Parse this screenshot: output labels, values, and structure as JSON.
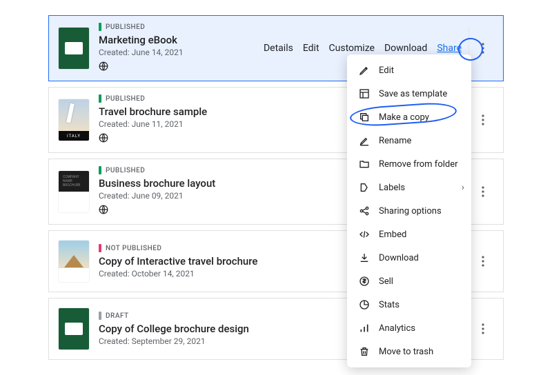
{
  "labels": {
    "created": "Created:",
    "details": "Details",
    "edit": "Edit",
    "customize": "Customize",
    "download": "Download",
    "share": "Share"
  },
  "status": {
    "published": "PUBLISHED",
    "not_published": "NOT PUBLISHED",
    "draft": "DRAFT"
  },
  "items": [
    {
      "title": "Marketing eBook",
      "date": "June 14, 2021",
      "status": "published",
      "selected": true,
      "show_customize": true
    },
    {
      "title": "Travel brochure sample",
      "date": "June 11, 2021",
      "status": "published",
      "selected": false,
      "show_customize": false
    },
    {
      "title": "Business brochure layout",
      "date": "June 09, 2021",
      "status": "published",
      "selected": false,
      "show_customize": false
    },
    {
      "title": "Copy of Interactive travel brochure",
      "date": "October 14, 2021",
      "status": "not_published",
      "selected": false,
      "show_customize": false
    },
    {
      "title": "Copy of College brochure design",
      "date": "September 29, 2021",
      "status": "draft",
      "selected": false,
      "show_customize": false
    }
  ],
  "menu": [
    {
      "icon": "pencil",
      "label": "Edit"
    },
    {
      "icon": "template",
      "label": "Save as template"
    },
    {
      "icon": "copy",
      "label": "Make a copy"
    },
    {
      "icon": "rename",
      "label": "Rename"
    },
    {
      "icon": "remove-folder",
      "label": "Remove from folder"
    },
    {
      "icon": "label",
      "label": "Labels",
      "submenu": true
    },
    {
      "icon": "share",
      "label": "Sharing options"
    },
    {
      "icon": "embed",
      "label": "Embed"
    },
    {
      "icon": "download",
      "label": "Download"
    },
    {
      "icon": "sell",
      "label": "Sell"
    },
    {
      "icon": "stats",
      "label": "Stats"
    },
    {
      "icon": "analytics",
      "label": "Analytics"
    },
    {
      "icon": "trash",
      "label": "Move to trash"
    }
  ],
  "annotations": {
    "kebab_circled": true,
    "make_a_copy_circled": true
  }
}
